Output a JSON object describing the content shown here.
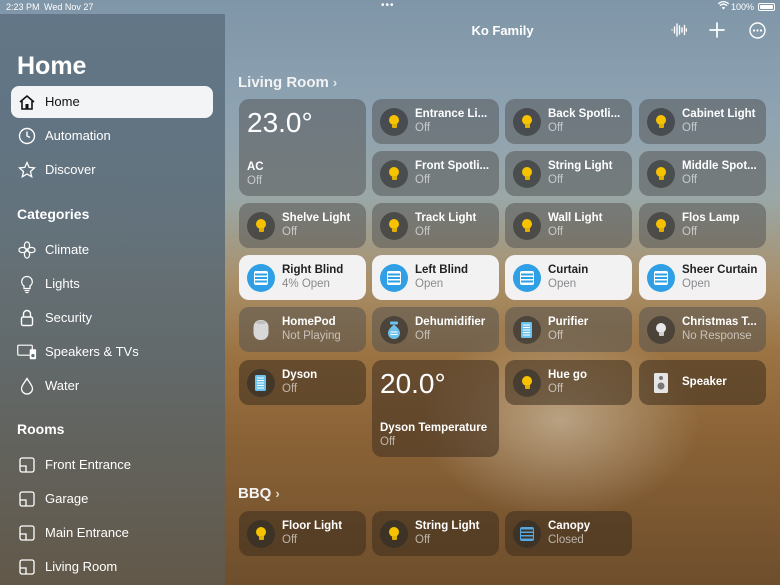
{
  "status_bar": {
    "time": "2:23 PM",
    "date": "Wed Nov 27",
    "battery": "100%"
  },
  "header": {
    "title": "Ko Family"
  },
  "sidebar": {
    "title": "Home",
    "main_items": [
      {
        "label": "Home",
        "icon": "house-icon"
      },
      {
        "label": "Automation",
        "icon": "clock-icon"
      },
      {
        "label": "Discover",
        "icon": "star-icon"
      }
    ],
    "categories_heading": "Categories",
    "categories": [
      {
        "label": "Climate",
        "icon": "fan-icon"
      },
      {
        "label": "Lights",
        "icon": "lightbulb-icon"
      },
      {
        "label": "Security",
        "icon": "lock-icon"
      },
      {
        "label": "Speakers & TVs",
        "icon": "tv-speaker-icon"
      },
      {
        "label": "Water",
        "icon": "water-drop-icon"
      }
    ],
    "rooms_heading": "Rooms",
    "rooms": [
      {
        "label": "Front Entrance"
      },
      {
        "label": "Garage"
      },
      {
        "label": "Main Entrance"
      },
      {
        "label": "Living Room"
      }
    ]
  },
  "living_room": {
    "title": "Living Room",
    "ac": {
      "temp": "23.0°",
      "name": "AC",
      "status": "Off"
    },
    "dyson_temp": {
      "temp": "20.0°",
      "name": "Dyson Temperature",
      "status": "Off"
    },
    "tiles": [
      {
        "name": "Entrance Li...",
        "status": "Off"
      },
      {
        "name": "Back Spotli...",
        "status": "Off"
      },
      {
        "name": "Cabinet Light",
        "status": "Off"
      },
      {
        "name": "Front Spotli...",
        "status": "Off"
      },
      {
        "name": "String Light",
        "status": "Off"
      },
      {
        "name": "Middle Spot...",
        "status": "Off"
      },
      {
        "name": "Shelve Light",
        "status": "Off"
      },
      {
        "name": "Track Light",
        "status": "Off"
      },
      {
        "name": "Wall Light",
        "status": "Off"
      },
      {
        "name": "Flos Lamp",
        "status": "Off"
      },
      {
        "name": "Right Blind",
        "status": "4% Open"
      },
      {
        "name": "Left Blind",
        "status": "Open"
      },
      {
        "name": "Curtain",
        "status": "Open"
      },
      {
        "name": "Sheer Curtain",
        "status": "Open"
      },
      {
        "name": "HomePod",
        "status": "Not Playing"
      },
      {
        "name": "Dehumidifier",
        "status": "Off"
      },
      {
        "name": "Purifier",
        "status": "Off"
      },
      {
        "name": "Christmas T...",
        "status": "No Response"
      },
      {
        "name": "Dyson",
        "status": "Off"
      },
      {
        "name": "Hue go",
        "status": "Off"
      },
      {
        "name": "Speaker",
        "status": ""
      }
    ]
  },
  "bbq": {
    "title": "BBQ",
    "tiles": [
      {
        "name": "Floor Light",
        "status": "Off"
      },
      {
        "name": "String Light",
        "status": "Off"
      },
      {
        "name": "Canopy",
        "status": "Closed"
      }
    ]
  }
}
